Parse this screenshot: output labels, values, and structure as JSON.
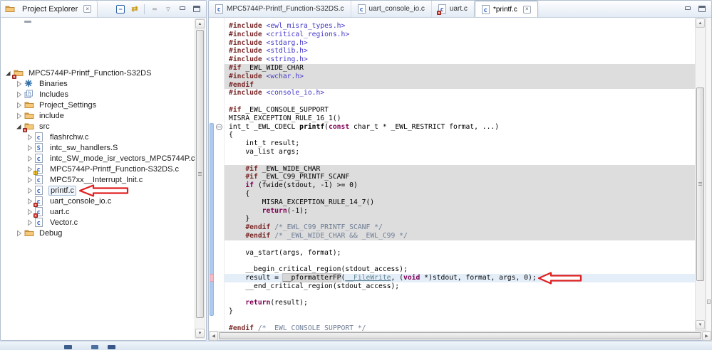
{
  "project_explorer": {
    "title": "Project Explorer",
    "toolbar_icons": [
      "collapse-all",
      "link-with-editor",
      "separator",
      "focus-disabled",
      "view-menu",
      "minimize",
      "maximize"
    ],
    "tree": [
      {
        "depth": 0,
        "twisty": "expanded",
        "icon": "project",
        "badge": "err",
        "label": "MPC5744P-Printf_Function-S32DS"
      },
      {
        "depth": 1,
        "twisty": "collapsed",
        "icon": "binaries",
        "badge": "",
        "label": "Binaries"
      },
      {
        "depth": 1,
        "twisty": "collapsed",
        "icon": "includes",
        "badge": "",
        "label": "Includes"
      },
      {
        "depth": 1,
        "twisty": "collapsed",
        "icon": "folder",
        "badge": "",
        "label": "Project_Settings"
      },
      {
        "depth": 1,
        "twisty": "collapsed",
        "icon": "folder",
        "badge": "",
        "label": "include"
      },
      {
        "depth": 1,
        "twisty": "expanded",
        "icon": "folder",
        "badge": "err",
        "label": "src"
      },
      {
        "depth": 2,
        "twisty": "collapsed",
        "icon": "cfile",
        "badge": "",
        "label": "flashrchw.c"
      },
      {
        "depth": 2,
        "twisty": "collapsed",
        "icon": "sfile",
        "badge": "",
        "label": "intc_sw_handlers.S"
      },
      {
        "depth": 2,
        "twisty": "collapsed",
        "icon": "cfile",
        "badge": "",
        "label": "intc_SW_mode_isr_vectors_MPC5744P.c"
      },
      {
        "depth": 2,
        "twisty": "collapsed",
        "icon": "cfile",
        "badge": "warn",
        "label": "MPC5744P-Printf_Function-S32DS.c"
      },
      {
        "depth": 2,
        "twisty": "collapsed",
        "icon": "cfile",
        "badge": "",
        "label": "MPC57xx__Interrupt_Init.c"
      },
      {
        "depth": 2,
        "twisty": "collapsed",
        "icon": "cfile",
        "badge": "",
        "label": "printf.c",
        "selected": true,
        "arrow": true
      },
      {
        "depth": 2,
        "twisty": "collapsed",
        "icon": "cfile",
        "badge": "err",
        "label": "uart_console_io.c"
      },
      {
        "depth": 2,
        "twisty": "collapsed",
        "icon": "cfile",
        "badge": "err",
        "label": "uart.c"
      },
      {
        "depth": 2,
        "twisty": "collapsed",
        "icon": "cfile",
        "badge": "",
        "label": "Vector.c"
      },
      {
        "depth": 1,
        "twisty": "collapsed",
        "icon": "folder-open",
        "badge": "",
        "label": "Debug"
      }
    ]
  },
  "editor": {
    "tabs": [
      {
        "label": "MPC5744P-Printf_Function-S32DS.c",
        "icon": "cfile",
        "badge": "",
        "active": false,
        "closable": false
      },
      {
        "label": "uart_console_io.c",
        "icon": "cfile",
        "badge": "",
        "active": false,
        "closable": false
      },
      {
        "label": "uart.c",
        "icon": "cfile",
        "badge": "err",
        "active": false,
        "closable": false
      },
      {
        "label": "*printf.c",
        "icon": "cfile",
        "badge": "",
        "active": true,
        "closable": true
      }
    ],
    "code": {
      "fold_line": 13,
      "range_start_line": 13,
      "range_end_line": 35,
      "current_line": 31,
      "occurrence_marker_line": 31,
      "arrow_line": 31,
      "lines": [
        {
          "bg": "",
          "segs": [
            [
              "d",
              "#include"
            ],
            [
              "p",
              " "
            ],
            [
              "h",
              "<ewl_misra_types.h>"
            ]
          ]
        },
        {
          "bg": "",
          "segs": [
            [
              "d",
              "#include"
            ],
            [
              "p",
              " "
            ],
            [
              "h",
              "<critical_regions.h>"
            ]
          ]
        },
        {
          "bg": "",
          "segs": [
            [
              "d",
              "#include"
            ],
            [
              "p",
              " "
            ],
            [
              "h",
              "<stdarg.h>"
            ]
          ]
        },
        {
          "bg": "",
          "segs": [
            [
              "d",
              "#include"
            ],
            [
              "p",
              " "
            ],
            [
              "h",
              "<stdlib.h>"
            ]
          ]
        },
        {
          "bg": "",
          "segs": [
            [
              "d",
              "#include"
            ],
            [
              "p",
              " "
            ],
            [
              "h",
              "<string.h>"
            ]
          ]
        },
        {
          "bg": "g",
          "segs": [
            [
              "d",
              "#if"
            ],
            [
              "p",
              " _EWL_WIDE_CHAR"
            ]
          ]
        },
        {
          "bg": "g",
          "segs": [
            [
              "d",
              "#include"
            ],
            [
              "p",
              " "
            ],
            [
              "h",
              "<wchar.h>"
            ]
          ]
        },
        {
          "bg": "g",
          "segs": [
            [
              "d",
              "#endif"
            ]
          ]
        },
        {
          "bg": "",
          "segs": [
            [
              "d",
              "#include"
            ],
            [
              "p",
              " "
            ],
            [
              "h",
              "<console_io.h>"
            ]
          ]
        },
        {
          "bg": "",
          "segs": []
        },
        {
          "bg": "",
          "segs": [
            [
              "d",
              "#if"
            ],
            [
              "p",
              " _EWL_CONSOLE_SUPPORT"
            ]
          ]
        },
        {
          "bg": "",
          "segs": [
            [
              "p",
              "MISRA_EXCEPTION_RULE_16_1()"
            ]
          ]
        },
        {
          "bg": "",
          "segs": [
            [
              "p",
              "int_t _EWL_CDECL "
            ],
            [
              "f",
              "printf"
            ],
            [
              "p",
              "("
            ],
            [
              "k",
              "const"
            ],
            [
              "p",
              " char_t * _EWL_RESTRICT format, ...)"
            ]
          ]
        },
        {
          "bg": "",
          "segs": [
            [
              "p",
              "{"
            ]
          ]
        },
        {
          "bg": "",
          "segs": [
            [
              "p",
              "    int_t result;"
            ]
          ]
        },
        {
          "bg": "",
          "segs": [
            [
              "p",
              "    va_list args;"
            ]
          ]
        },
        {
          "bg": "",
          "segs": []
        },
        {
          "bg": "g",
          "segs": [
            [
              "p",
              "    "
            ],
            [
              "d",
              "#if"
            ],
            [
              "p",
              " _EWL_WIDE_CHAR"
            ]
          ]
        },
        {
          "bg": "g",
          "segs": [
            [
              "p",
              "    "
            ],
            [
              "d",
              "#if"
            ],
            [
              "p",
              " _EWL_C99_PRINTF_SCANF"
            ]
          ]
        },
        {
          "bg": "g",
          "segs": [
            [
              "p",
              "    "
            ],
            [
              "k",
              "if"
            ],
            [
              "p",
              " (fwide(stdout, -1) >= 0)"
            ]
          ]
        },
        {
          "bg": "g",
          "segs": [
            [
              "p",
              "    {"
            ]
          ]
        },
        {
          "bg": "g",
          "segs": [
            [
              "p",
              "        MISRA_EXCEPTION_RULE_14_7()"
            ]
          ]
        },
        {
          "bg": "g",
          "segs": [
            [
              "p",
              "        "
            ],
            [
              "k",
              "return"
            ],
            [
              "p",
              "(-1);"
            ]
          ]
        },
        {
          "bg": "g",
          "segs": [
            [
              "p",
              "    }"
            ]
          ]
        },
        {
          "bg": "g",
          "segs": [
            [
              "p",
              "    "
            ],
            [
              "d",
              "#endif"
            ],
            [
              "p",
              " "
            ],
            [
              "c",
              "/*_EWL_C99_PRINTF_SCANF */"
            ]
          ]
        },
        {
          "bg": "g",
          "segs": [
            [
              "p",
              "    "
            ],
            [
              "d",
              "#endif"
            ],
            [
              "p",
              " "
            ],
            [
              "c",
              "/* _EWL_WIDE_CHAR && _EWL_C99 */"
            ]
          ]
        },
        {
          "bg": "",
          "segs": []
        },
        {
          "bg": "",
          "segs": [
            [
              "p",
              "    va_start(args, format);"
            ]
          ]
        },
        {
          "bg": "",
          "segs": []
        },
        {
          "bg": "",
          "segs": [
            [
              "p",
              "    __begin_critical_region(stdout_access);"
            ]
          ]
        },
        {
          "bg": "cur",
          "segs": [
            [
              "p",
              "    result = "
            ],
            [
              "o",
              "__pformatterFP"
            ],
            [
              "p",
              "("
            ],
            [
              "l",
              "__FileWrite"
            ],
            [
              "p",
              ", ("
            ],
            [
              "k",
              "void"
            ],
            [
              "p",
              " *)stdout, format, args, 0);"
            ]
          ]
        },
        {
          "bg": "",
          "segs": [
            [
              "p",
              "    __end_critical_region(stdout_access);"
            ]
          ]
        },
        {
          "bg": "",
          "segs": []
        },
        {
          "bg": "",
          "segs": [
            [
              "p",
              "    "
            ],
            [
              "k",
              "return"
            ],
            [
              "p",
              "(result);"
            ]
          ]
        },
        {
          "bg": "",
          "segs": [
            [
              "p",
              "}"
            ]
          ]
        },
        {
          "bg": "",
          "segs": []
        },
        {
          "bg": "",
          "segs": [
            [
              "d",
              "#endif"
            ],
            [
              "p",
              " "
            ],
            [
              "c",
              "/* _EWL_CONSOLE_SUPPORT */"
            ]
          ]
        }
      ]
    }
  },
  "colors": {
    "annotation_arrow": "#e02020",
    "inactive_code_background": "#dddddd",
    "current_line_background": "#e4eef9",
    "preprocessor_directive": "#7a2a2a",
    "keyword": "#7f0055",
    "include_string": "#4338c8",
    "comment": "#6e7e96",
    "linked_symbol": "#5f8290",
    "range_indicator": "#adcbec",
    "occurrence_ruler_mark": "#f3bcc6"
  },
  "close_glyph": "×"
}
